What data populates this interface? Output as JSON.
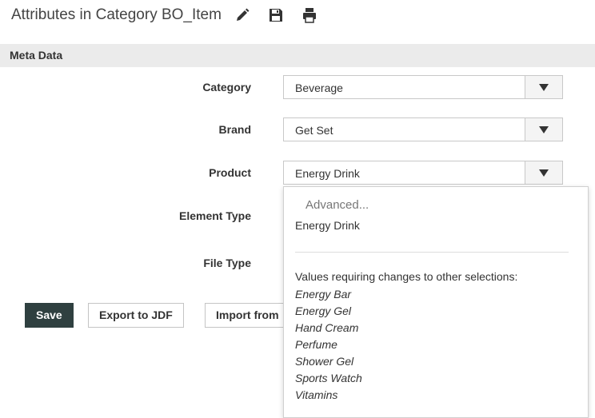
{
  "header": {
    "title": "Attributes in Category BO_Item",
    "icons": [
      "pencil-icon",
      "save-icon",
      "print-icon"
    ]
  },
  "section": {
    "title": "Meta Data"
  },
  "fields": {
    "category": {
      "label": "Category",
      "value": "Beverage"
    },
    "brand": {
      "label": "Brand",
      "value": "Get Set"
    },
    "product": {
      "label": "Product",
      "value": "Energy Drink"
    },
    "element_type": {
      "label": "Element Type"
    },
    "file_type": {
      "label": "File Type"
    }
  },
  "buttons": {
    "save": "Save",
    "export": "Export to JDF",
    "import": "Import from"
  },
  "dropdown": {
    "advanced": "Advanced...",
    "current": "Energy Drink",
    "heading": "Values requiring changes to other selections:",
    "options": [
      "Energy Bar",
      "Energy Gel",
      "Hand Cream",
      "Perfume",
      "Shower Gel",
      "Sports Watch",
      "Vitamins"
    ]
  },
  "colors": {
    "primary_button": "#2f4040",
    "section_bar": "#ebebeb"
  }
}
